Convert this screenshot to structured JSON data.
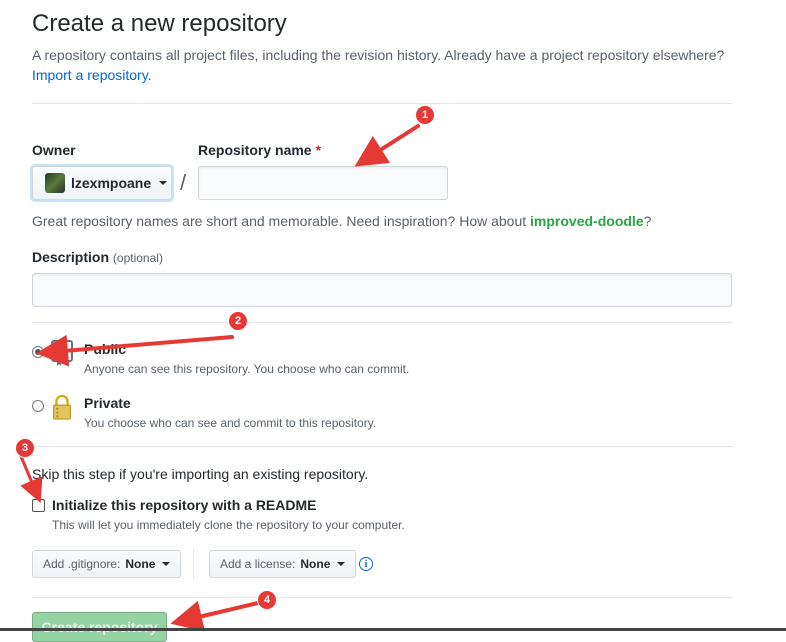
{
  "header": {
    "title": "Create a new repository",
    "subtitle": "A repository contains all project files, including the revision history. Already have a project repository elsewhere?",
    "import_link": "Import a repository."
  },
  "owner": {
    "label": "Owner",
    "value": "lzexmpoane",
    "slash": "/"
  },
  "repo_name": {
    "label": "Repository name",
    "required_mark": "*",
    "value": "",
    "hint_prefix": "Great repository names are short and memorable. Need inspiration? How about ",
    "suggestion": "improved-doodle",
    "hint_suffix": "?"
  },
  "description": {
    "label": "Description",
    "optional": "(optional)",
    "value": ""
  },
  "visibility": {
    "public": {
      "title": "Public",
      "desc": "Anyone can see this repository. You choose who can commit.",
      "checked": true
    },
    "private": {
      "title": "Private",
      "desc": "You choose who can see and commit to this repository.",
      "checked": false
    }
  },
  "init": {
    "skip_text": "Skip this step if you're importing an existing repository.",
    "readme_label": "Initialize this repository with a README",
    "readme_desc": "This will let you immediately clone the repository to your computer.",
    "readme_checked": false
  },
  "addons": {
    "gitignore_prefix": "Add .gitignore:",
    "gitignore_value": "None",
    "license_prefix": "Add a license:",
    "license_value": "None",
    "info_glyph": "i"
  },
  "submit": {
    "label": "Create repository"
  },
  "annotations": {
    "badge1": "1",
    "badge2": "2",
    "badge3": "3",
    "badge4": "4",
    "color": "#e53935"
  },
  "colors": {
    "link": "#0366d6",
    "suggestion": "#28a745",
    "required": "#cb2431",
    "create_button_disabled": "#94d3a2"
  },
  "icons": {
    "owner_caret": "chevron-down-icon",
    "public_repo": "repo-icon",
    "private_repo": "lock-icon",
    "info": "info-icon"
  }
}
